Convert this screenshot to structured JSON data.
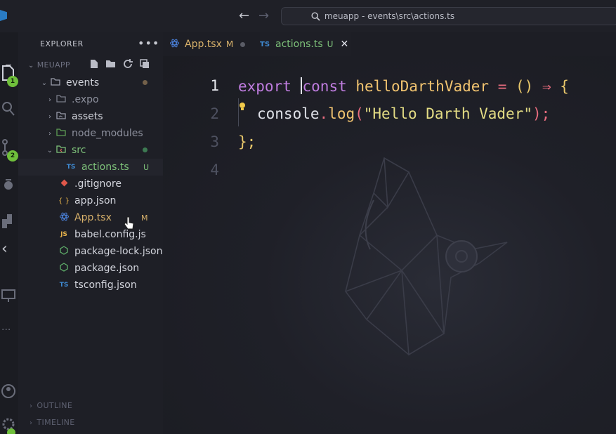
{
  "titlebar": {
    "back_glyph": "←",
    "forward_glyph": "→",
    "search_icon": "search-icon",
    "command_center": "meuapp - events\\src\\actions.ts"
  },
  "activitybar": {
    "explorer_badge": "1",
    "scm_badge": "2",
    "collapse_glyph": "‹"
  },
  "sidebar": {
    "title": "EXPLORER",
    "more": "•••",
    "root": "MEUAPP",
    "items": [
      {
        "label": "events",
        "status": ""
      },
      {
        "label": ".expo",
        "status": ""
      },
      {
        "label": "assets",
        "status": ""
      },
      {
        "label": "node_modules",
        "status": ""
      },
      {
        "label": "src",
        "status": ""
      },
      {
        "label": "actions.ts",
        "status": "U"
      },
      {
        "label": ".gitignore",
        "status": ""
      },
      {
        "label": "app.json",
        "status": ""
      },
      {
        "label": "App.tsx",
        "status": "M"
      },
      {
        "label": "babel.config.js",
        "status": ""
      },
      {
        "label": "package-lock.json",
        "status": ""
      },
      {
        "label": "package.json",
        "status": ""
      },
      {
        "label": "tsconfig.json",
        "status": ""
      }
    ],
    "outline": "OUTLINE",
    "timeline": "TIMELINE"
  },
  "tabs": [
    {
      "label": "App.tsx",
      "flag": "M"
    },
    {
      "label": "actions.ts",
      "flag": "U",
      "icon_text": "TS"
    }
  ],
  "editor": {
    "line_numbers": [
      "1",
      "2",
      "3",
      "4"
    ],
    "line1": {
      "export": "export",
      "const": "const",
      "name": "helloDarthVader",
      "eq": "=",
      "parens": "()",
      "arrow": "⇒",
      "open": "{"
    },
    "line2": {
      "obj": "console",
      "dot": ".",
      "method": "log",
      "open": "(",
      "str": "\"Hello Darth Vader\"",
      "close": ");"
    },
    "line3": {
      "close": "};"
    }
  },
  "icons": {
    "ts_label": "TS",
    "json_label": "{ }",
    "js_label": "JS",
    "tsconfig_label": "TS"
  },
  "colors": {
    "accent_green": "#6fbf3b",
    "modified": "#d9b26b",
    "untracked": "#73c991"
  }
}
